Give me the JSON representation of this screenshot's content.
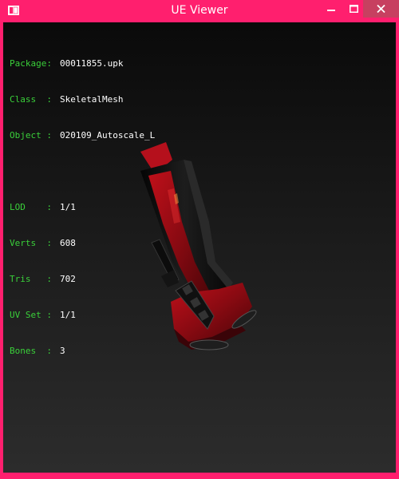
{
  "window": {
    "title": "UE Viewer",
    "accent": "#ff1f6e",
    "icons": {
      "app": "app-icon",
      "minimize": "minimize-icon",
      "maximize": "maximize-icon",
      "close": "close-icon"
    }
  },
  "info": {
    "object_fields": [
      {
        "key": "Package:",
        "value": "00011855.upk"
      },
      {
        "key": "Class  :",
        "value": "SkeletalMesh"
      },
      {
        "key": "Object :",
        "value": "020109_Autoscale_L"
      }
    ],
    "mesh_fields": [
      {
        "key": "LOD    :",
        "value": "1/1"
      },
      {
        "key": "Verts  :",
        "value": "608"
      },
      {
        "key": "Tris   :",
        "value": "702"
      },
      {
        "key": "UV Set :",
        "value": "1/1"
      },
      {
        "key": "Bones  :",
        "value": "3"
      }
    ],
    "label_color": "#3ad03a",
    "value_color": "#ffffff"
  }
}
